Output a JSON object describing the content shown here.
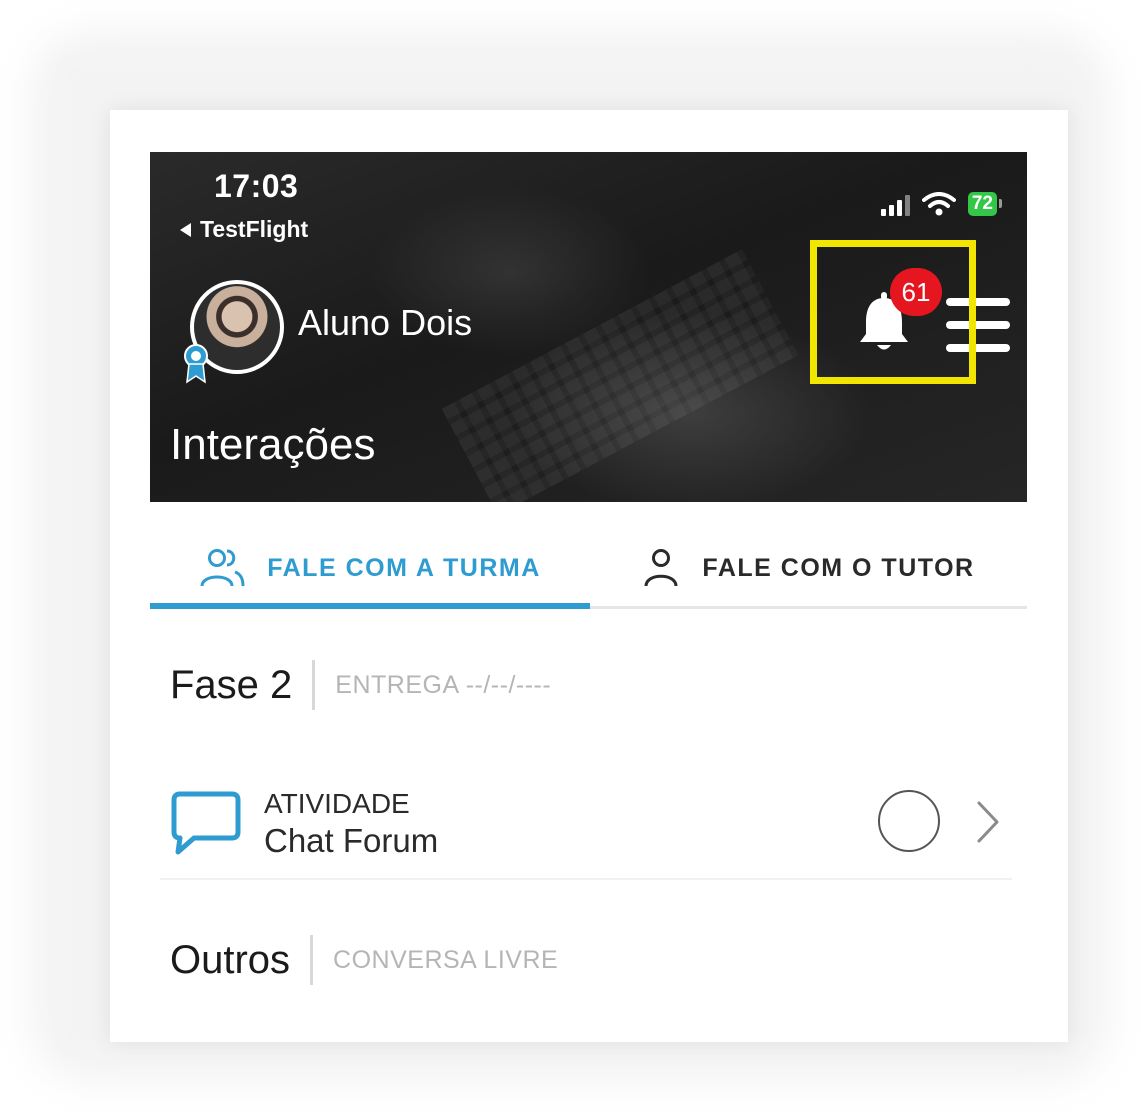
{
  "status_bar": {
    "time": "17:03",
    "back_app": "TestFlight",
    "battery": "72"
  },
  "profile": {
    "name": "Aluno Dois"
  },
  "header": {
    "title": "Interações"
  },
  "notifications": {
    "count": "61"
  },
  "tabs": [
    {
      "label": "FALE COM A TURMA",
      "active": true,
      "icon": "group-icon"
    },
    {
      "label": "FALE COM O TUTOR",
      "active": false,
      "icon": "person-icon"
    }
  ],
  "sections": [
    {
      "title": "Fase 2",
      "subtitle": "ENTREGA --/--/----",
      "items": [
        {
          "label": "ATIVIDADE",
          "name": "Chat Forum",
          "icon": "chat-bubble-icon"
        }
      ]
    },
    {
      "title": "Outros",
      "subtitle": "CONVERSA LIVRE",
      "items": []
    }
  ],
  "colors": {
    "accent": "#2f9cd1",
    "highlight": "#f2e600",
    "badge": "#e5161f",
    "battery": "#33c748"
  }
}
